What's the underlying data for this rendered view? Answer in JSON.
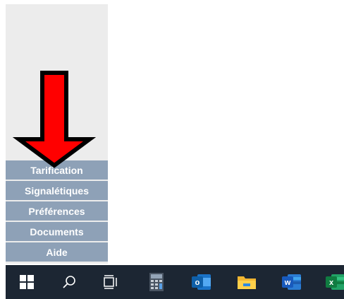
{
  "menu": {
    "items": [
      {
        "label": "Tarification"
      },
      {
        "label": "Signalétiques"
      },
      {
        "label": "Préférences"
      },
      {
        "label": "Documents"
      },
      {
        "label": "Aide"
      }
    ]
  },
  "annotation": {
    "type": "arrow-down",
    "fill_color": "#ff0000",
    "stroke_color": "#000000"
  },
  "taskbar": {
    "icons": [
      {
        "name": "windows-start-icon"
      },
      {
        "name": "search-icon"
      },
      {
        "name": "task-view-icon"
      },
      {
        "name": "calculator-icon"
      },
      {
        "name": "outlook-icon",
        "letter": "o"
      },
      {
        "name": "file-explorer-icon"
      },
      {
        "name": "word-icon",
        "letter": "w"
      },
      {
        "name": "excel-icon",
        "letter": "x"
      }
    ]
  },
  "colors": {
    "sidebar_bg": "#ececec",
    "menu_item_bg": "#8ea1b7",
    "taskbar_bg": "#1c2633"
  }
}
